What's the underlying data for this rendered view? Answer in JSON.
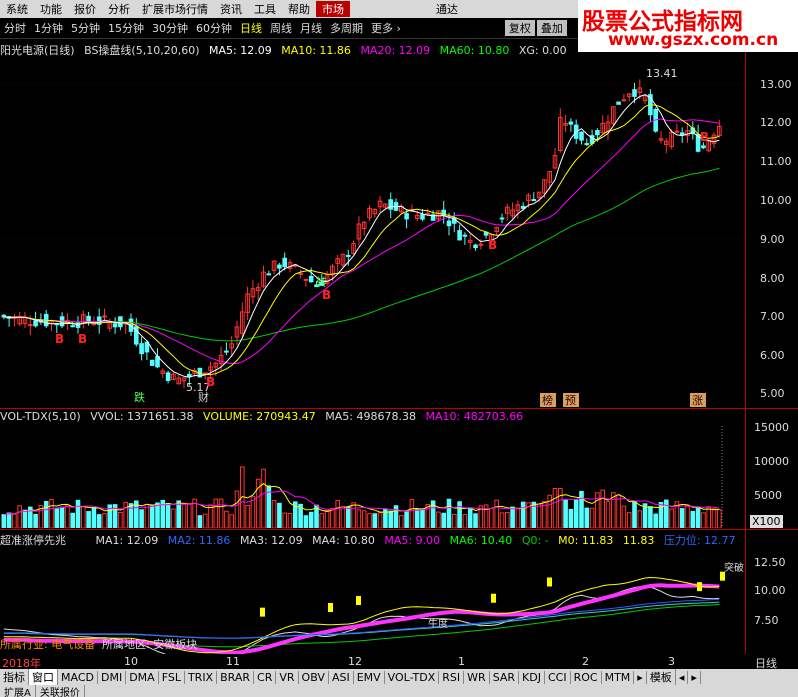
{
  "menu": [
    "系统",
    "功能",
    "报价",
    "分析",
    "扩展市场行情",
    "资讯",
    "工具",
    "帮助",
    "市场",
    "通达"
  ],
  "menu_highlight": "市场",
  "watermark": {
    "line1": "股票公式指标网",
    "line2": "www.gszx.com.cn"
  },
  "periods": [
    "分时",
    "1分钟",
    "5分钟",
    "15分钟",
    "30分钟",
    "60分钟",
    "日线",
    "周线",
    "月线",
    "多周期",
    "更多 ›"
  ],
  "active_period": "日线",
  "period_right": [
    "复权",
    "叠加"
  ],
  "main_header": {
    "stock": "阳光电源(日线)",
    "indicator": "BS操盘线(5,10,20,60)",
    "ma5": "MA5: 12.09",
    "ma10": "MA10: 11.86",
    "ma20": "MA20: 12.09",
    "ma60": "MA60: 10.80",
    "xg": "XG: 0.00"
  },
  "main_axis": [
    "13.00",
    "12.00",
    "11.00",
    "10.00",
    "9.00",
    "8.00",
    "7.00",
    "6.00",
    "5.00"
  ],
  "main_annotations": {
    "high": "13.41",
    "low": "5.17",
    "labels": [
      "跌",
      "财",
      "B",
      "B",
      "B",
      "B",
      "B",
      "B",
      "转",
      "榜",
      "预",
      "涨"
    ]
  },
  "vol_header": {
    "name": "VOL-TDX(5,10)",
    "vvol": "VVOL: 1371651.38",
    "volume": "VOLUME: 270943.47",
    "ma5": "MA5: 498678.38",
    "ma10": "MA10: 482703.66"
  },
  "vol_axis": [
    "15000",
    "10000",
    "5000"
  ],
  "vol_unit": "X100",
  "ind_header": {
    "name": "超准涨停先兆",
    "ma1": "MA1: 12.09",
    "ma2": "MA2: 11.86",
    "ma3": "MA3: 12.09",
    "ma4": "MA4: 10.80",
    "ma5": "MA5: 9.00",
    "ma6": "MA6: 10.40",
    "q": "Q0: -",
    "m0": "M0: 11.83",
    "m0b": "11.83",
    "yl": "压力位: 12.77"
  },
  "ind_axis": [
    "12.50",
    "10.00",
    "7.50"
  ],
  "ind_annotations": {
    "mid": "牛度",
    "right": "突破"
  },
  "ind_footer": {
    "industry": "所属行业: 电气设备",
    "region": "所属地区: 安徽板块"
  },
  "date_axis": [
    "2018年",
    "10",
    "11",
    "12",
    "1",
    "2",
    "3"
  ],
  "date_axis_right": "日线",
  "tabs": [
    "指标",
    "窗口",
    "MACD",
    "DMI",
    "DMA",
    "FSL",
    "TRIX",
    "BRAR",
    "CR",
    "VR",
    "OBV",
    "ASI",
    "EMV",
    "VOL-TDX",
    "RSI",
    "WR",
    "SAR",
    "KDJ",
    "CCI",
    "ROC",
    "MTM",
    "▸",
    "模板",
    "◂",
    "▸"
  ],
  "status": [
    "扩展A",
    "关联报价"
  ],
  "colors": {
    "up": "#ff3333",
    "down": "#54ffff",
    "ma5": "#ffffff",
    "ma10": "#ffff00",
    "ma20": "#ff00ff",
    "ma60": "#00cc00",
    "vol": "#54ffff",
    "axis_border": "#aa0000"
  }
}
